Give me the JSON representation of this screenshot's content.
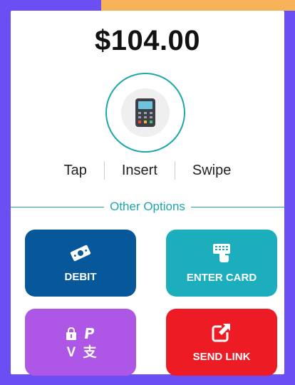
{
  "payment": {
    "amount": "$104.00"
  },
  "methods": {
    "tap": "Tap",
    "insert": "Insert",
    "swipe": "Swipe"
  },
  "other_options": {
    "label": "Other Options"
  },
  "options": {
    "debit": {
      "label": "DEBIT",
      "color": "#07589b",
      "icon": "cash-icon"
    },
    "enter_card": {
      "label": "ENTER CARD",
      "color": "#1daebd",
      "icon": "keypad-icon"
    },
    "wallets": {
      "color": "#ae56e6",
      "icons": [
        "applepay-icon",
        "paypal-icon",
        "venmo-icon",
        "alipay-icon"
      ],
      "venmo_glyph": "V",
      "alipay_glyph": "支"
    },
    "send_link": {
      "label": "SEND LINK",
      "color": "#ec1b24",
      "icon": "external-link-icon"
    }
  },
  "colors": {
    "background": "#6c4ff3",
    "accent": "#1ea6ad",
    "top_strip": "#f7b35a"
  }
}
